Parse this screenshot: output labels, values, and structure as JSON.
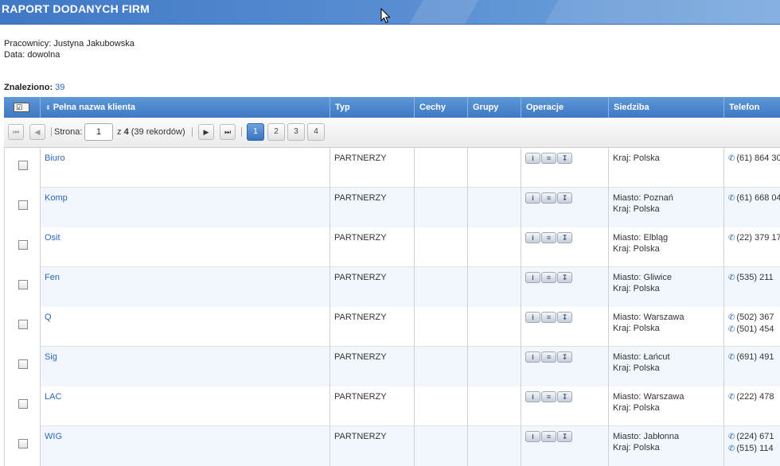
{
  "header": {
    "title": "RAPORT DODANYCH FIRM"
  },
  "meta": {
    "employees": "Pracownicy: Justyna Jakubowska",
    "date": "Data: dowolna"
  },
  "found": {
    "label": "Znaleziono:",
    "count": "39"
  },
  "columns": {
    "name": "Pełna nazwa klienta",
    "type": "Typ",
    "features": "Cechy",
    "groups": "Grupy",
    "operations": "Operacje",
    "seat": "Siedziba",
    "phone": "Telefon"
  },
  "pager": {
    "page_label": "Strona:",
    "current_page": "1",
    "of_prefix": "z",
    "total_pages": "4",
    "records_text": "(39 rekordów)",
    "pages": [
      "1",
      "2",
      "3",
      "4"
    ]
  },
  "icons": {
    "info": "info-icon",
    "list": "list-icon",
    "download": "download-icon",
    "phone": "phone-icon"
  },
  "rows": [
    {
      "name": "Biuro",
      "type": "PARTNERZY",
      "seat": [
        "Kraj: Polska"
      ],
      "phones": [
        "(61) 864 30"
      ]
    },
    {
      "name": "Komp",
      "type": "PARTNERZY",
      "seat": [
        "Miasto: Poznań",
        "Kraj: Polska"
      ],
      "phones": [
        "(61) 668 04"
      ]
    },
    {
      "name": "Osit",
      "type": "PARTNERZY",
      "seat": [
        "Miasto: Elbląg",
        "Kraj: Polska"
      ],
      "phones": [
        "(22) 379 17"
      ]
    },
    {
      "name": "Fen",
      "type": "PARTNERZY",
      "seat": [
        "Miasto: Gliwice",
        "Kraj: Polska"
      ],
      "phones": [
        "(535) 211"
      ]
    },
    {
      "name": "Q",
      "type": "PARTNERZY",
      "seat": [
        "Miasto: Warszawa",
        "Kraj: Polska"
      ],
      "phones": [
        "(502) 367",
        "(501) 454"
      ]
    },
    {
      "name": "Sig",
      "type": "PARTNERZY",
      "seat": [
        "Miasto: Łańcut",
        "Kraj: Polska"
      ],
      "phones": [
        "(691) 491"
      ]
    },
    {
      "name": "LAC",
      "type": "PARTNERZY",
      "seat": [
        "Miasto: Warszawa",
        "Kraj: Polska"
      ],
      "phones": [
        "(222) 478"
      ]
    },
    {
      "name": "WIG",
      "type": "PARTNERZY",
      "seat": [
        "Miasto: Jabłonna",
        "Kraj: Polska"
      ],
      "phones": [
        "(224) 671",
        "(515) 114"
      ]
    }
  ]
}
